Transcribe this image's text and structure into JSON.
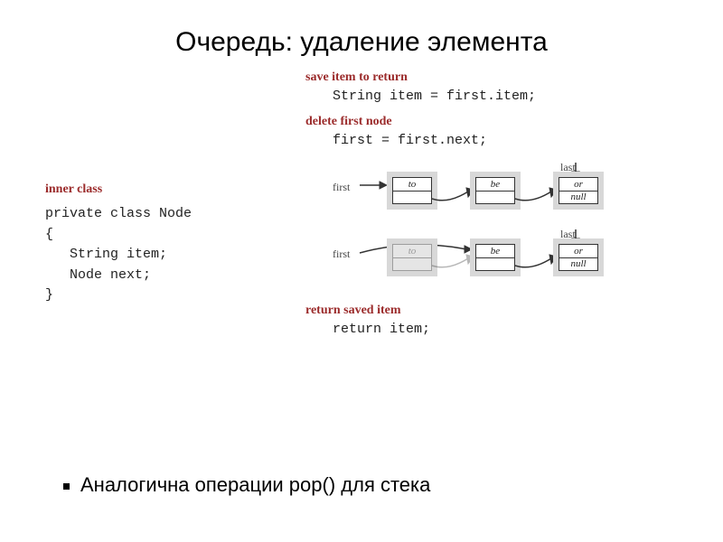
{
  "title": "Очередь: удаление элемента",
  "left": {
    "label": "inner class",
    "code": "private class Node\n{\n   String item;\n   Node next;\n}"
  },
  "right": {
    "s1": {
      "label": "save item to return",
      "code": "String item = first.item;"
    },
    "s2": {
      "label": "delete first node",
      "code": "first = first.next;"
    },
    "nodes": {
      "to": "to",
      "be": "be",
      "or": "or",
      "null": "null",
      "first": "first",
      "last": "last"
    },
    "s3": {
      "label": "return saved item",
      "code": "return item;"
    }
  },
  "bullet": "Аналогична операции pop() для стека"
}
